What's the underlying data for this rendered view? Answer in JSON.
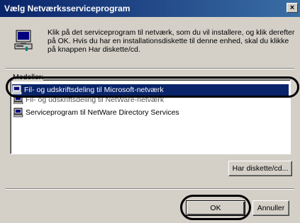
{
  "window": {
    "title": "Vælg Netværksserviceprogram",
    "close_glyph": "×"
  },
  "instructions": "Klik på det serviceprogram til netværk, som du vil installere, og klik derefter på OK. Hvis du har en installationsdiskette til denne enhed, skal du klikke på knappen Har diskette/cd.",
  "list": {
    "label": "Modeller:",
    "items": [
      {
        "label": "Fil- og udskriftsdeling til Microsoft-netværk",
        "selected": true
      },
      {
        "label": "Fil- og udskriftsdeling til NetWare-netværk",
        "selected": false
      },
      {
        "label": "Serviceprogram til NetWare Directory Services",
        "selected": false
      }
    ]
  },
  "buttons": {
    "have_disk": "Har diskette/cd...",
    "ok": "OK",
    "cancel": "Annuller"
  },
  "colors": {
    "titlebar": "#0a246a",
    "selection": "#0a246a",
    "dialog_bg": "#d4d0c8"
  },
  "icons": {
    "network_service": "network-service-icon"
  }
}
